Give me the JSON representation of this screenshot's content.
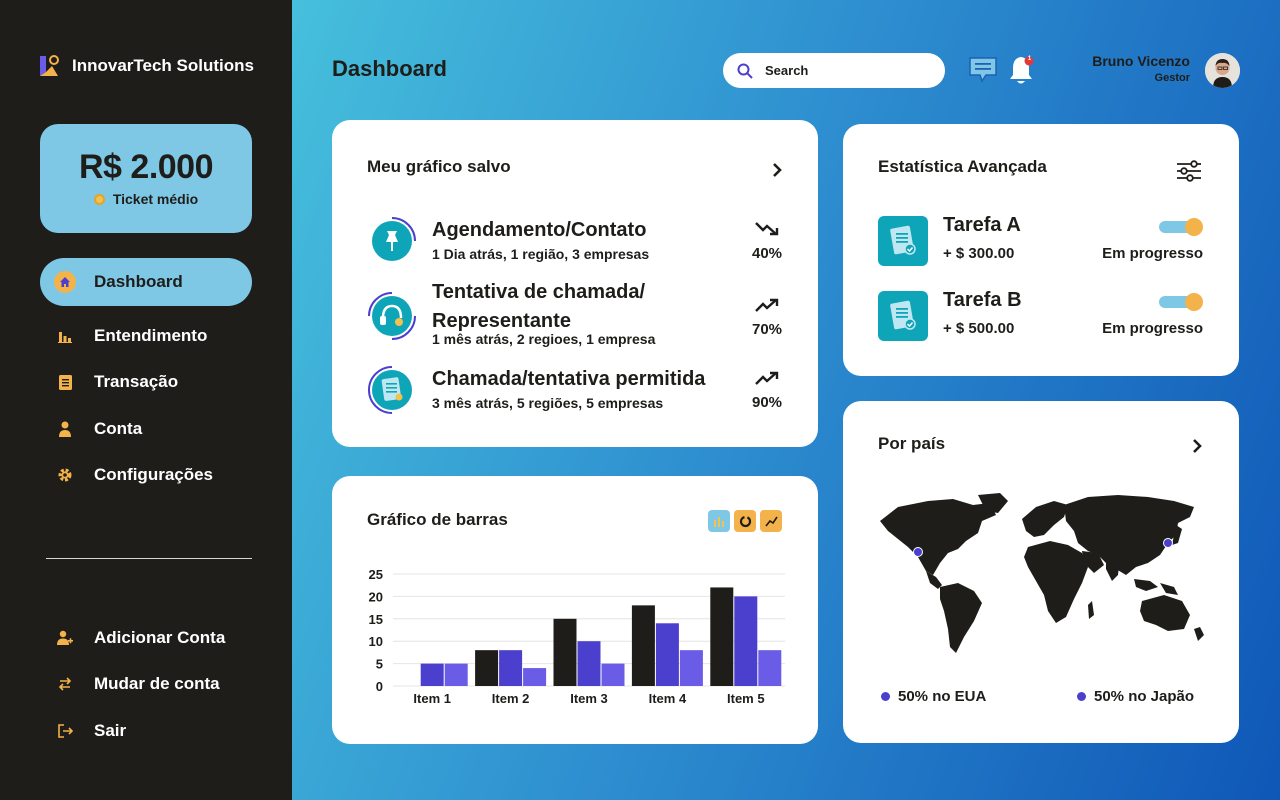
{
  "brand": {
    "name": "InnovarTech Solutions"
  },
  "ticket": {
    "value": "R$ 2.000",
    "label": "Ticket médio"
  },
  "sidebar": {
    "items": [
      {
        "label": "Dashboard",
        "icon": "home-icon",
        "active": true
      },
      {
        "label": "Entendimento",
        "icon": "bar-chart-icon"
      },
      {
        "label": "Transação",
        "icon": "document-icon"
      },
      {
        "label": "Conta",
        "icon": "user-icon"
      },
      {
        "label": "Configurações",
        "icon": "gear-icon"
      }
    ],
    "bottom_items": [
      {
        "label": "Adicionar Conta",
        "icon": "add-user-icon"
      },
      {
        "label": "Mudar de conta",
        "icon": "switch-icon"
      },
      {
        "label": "Sair",
        "icon": "logout-icon"
      }
    ]
  },
  "header": {
    "title": "Dashboard",
    "search_placeholder": "Search",
    "notification_badge": "1",
    "user": {
      "name": "Bruno Vicenzo",
      "role": "Gestor"
    }
  },
  "saved_chart": {
    "title": "Meu gráfico salvo",
    "items": [
      {
        "name": "Agendamento/Contato",
        "meta": "1 Dia atrás, 1 região, 3 empresas",
        "trend": "down",
        "pct": "40%",
        "icon": "pin-icon"
      },
      {
        "name": "Tentativa de chamada/ Representante",
        "meta": "1 mês atrás, 2 regioes, 1 empresa",
        "trend": "up",
        "pct": "70%",
        "icon": "headset-icon"
      },
      {
        "name": "Chamada/tentativa permitida",
        "meta": "3 mês atrás, 5 regiões, 5 empresas",
        "trend": "up",
        "pct": "90%",
        "icon": "notes-icon"
      }
    ]
  },
  "advanced_stats": {
    "title": "Estatística Avançada",
    "tasks": [
      {
        "name": "Tarefa A",
        "amount": "+ $ 300.00",
        "status": "Em progresso",
        "on": true
      },
      {
        "name": "Tarefa B",
        "amount": "+ $ 500.00",
        "status": "Em progresso",
        "on": true
      }
    ]
  },
  "bar_chart_card": {
    "title": "Gráfico de barras"
  },
  "chart_data": {
    "type": "bar",
    "categories": [
      "Item 1",
      "Item 2",
      "Item 3",
      "Item 4",
      "Item 5"
    ],
    "series": [
      {
        "values": [
          0,
          8,
          15,
          18,
          22
        ],
        "color": "#1e1d1a"
      },
      {
        "values": [
          5,
          8,
          10,
          14,
          20
        ],
        "color": "#4b3fce"
      },
      {
        "values": [
          5,
          4,
          5,
          8,
          8
        ],
        "color": "#6b5ce7"
      }
    ],
    "yticks": [
      0,
      5,
      10,
      15,
      20,
      25
    ],
    "ylim": [
      0,
      25
    ],
    "grid": true
  },
  "by_country": {
    "title": "Por país",
    "legend": [
      {
        "label": "50% no EUA",
        "color": "#4b3fce"
      },
      {
        "label": "50% no Japão",
        "color": "#4b3fce"
      }
    ]
  },
  "colors": {
    "accent": "#7ec8e6",
    "orange": "#f3b24a",
    "dark": "#1e1d1a",
    "purple": "#4b3fce"
  }
}
